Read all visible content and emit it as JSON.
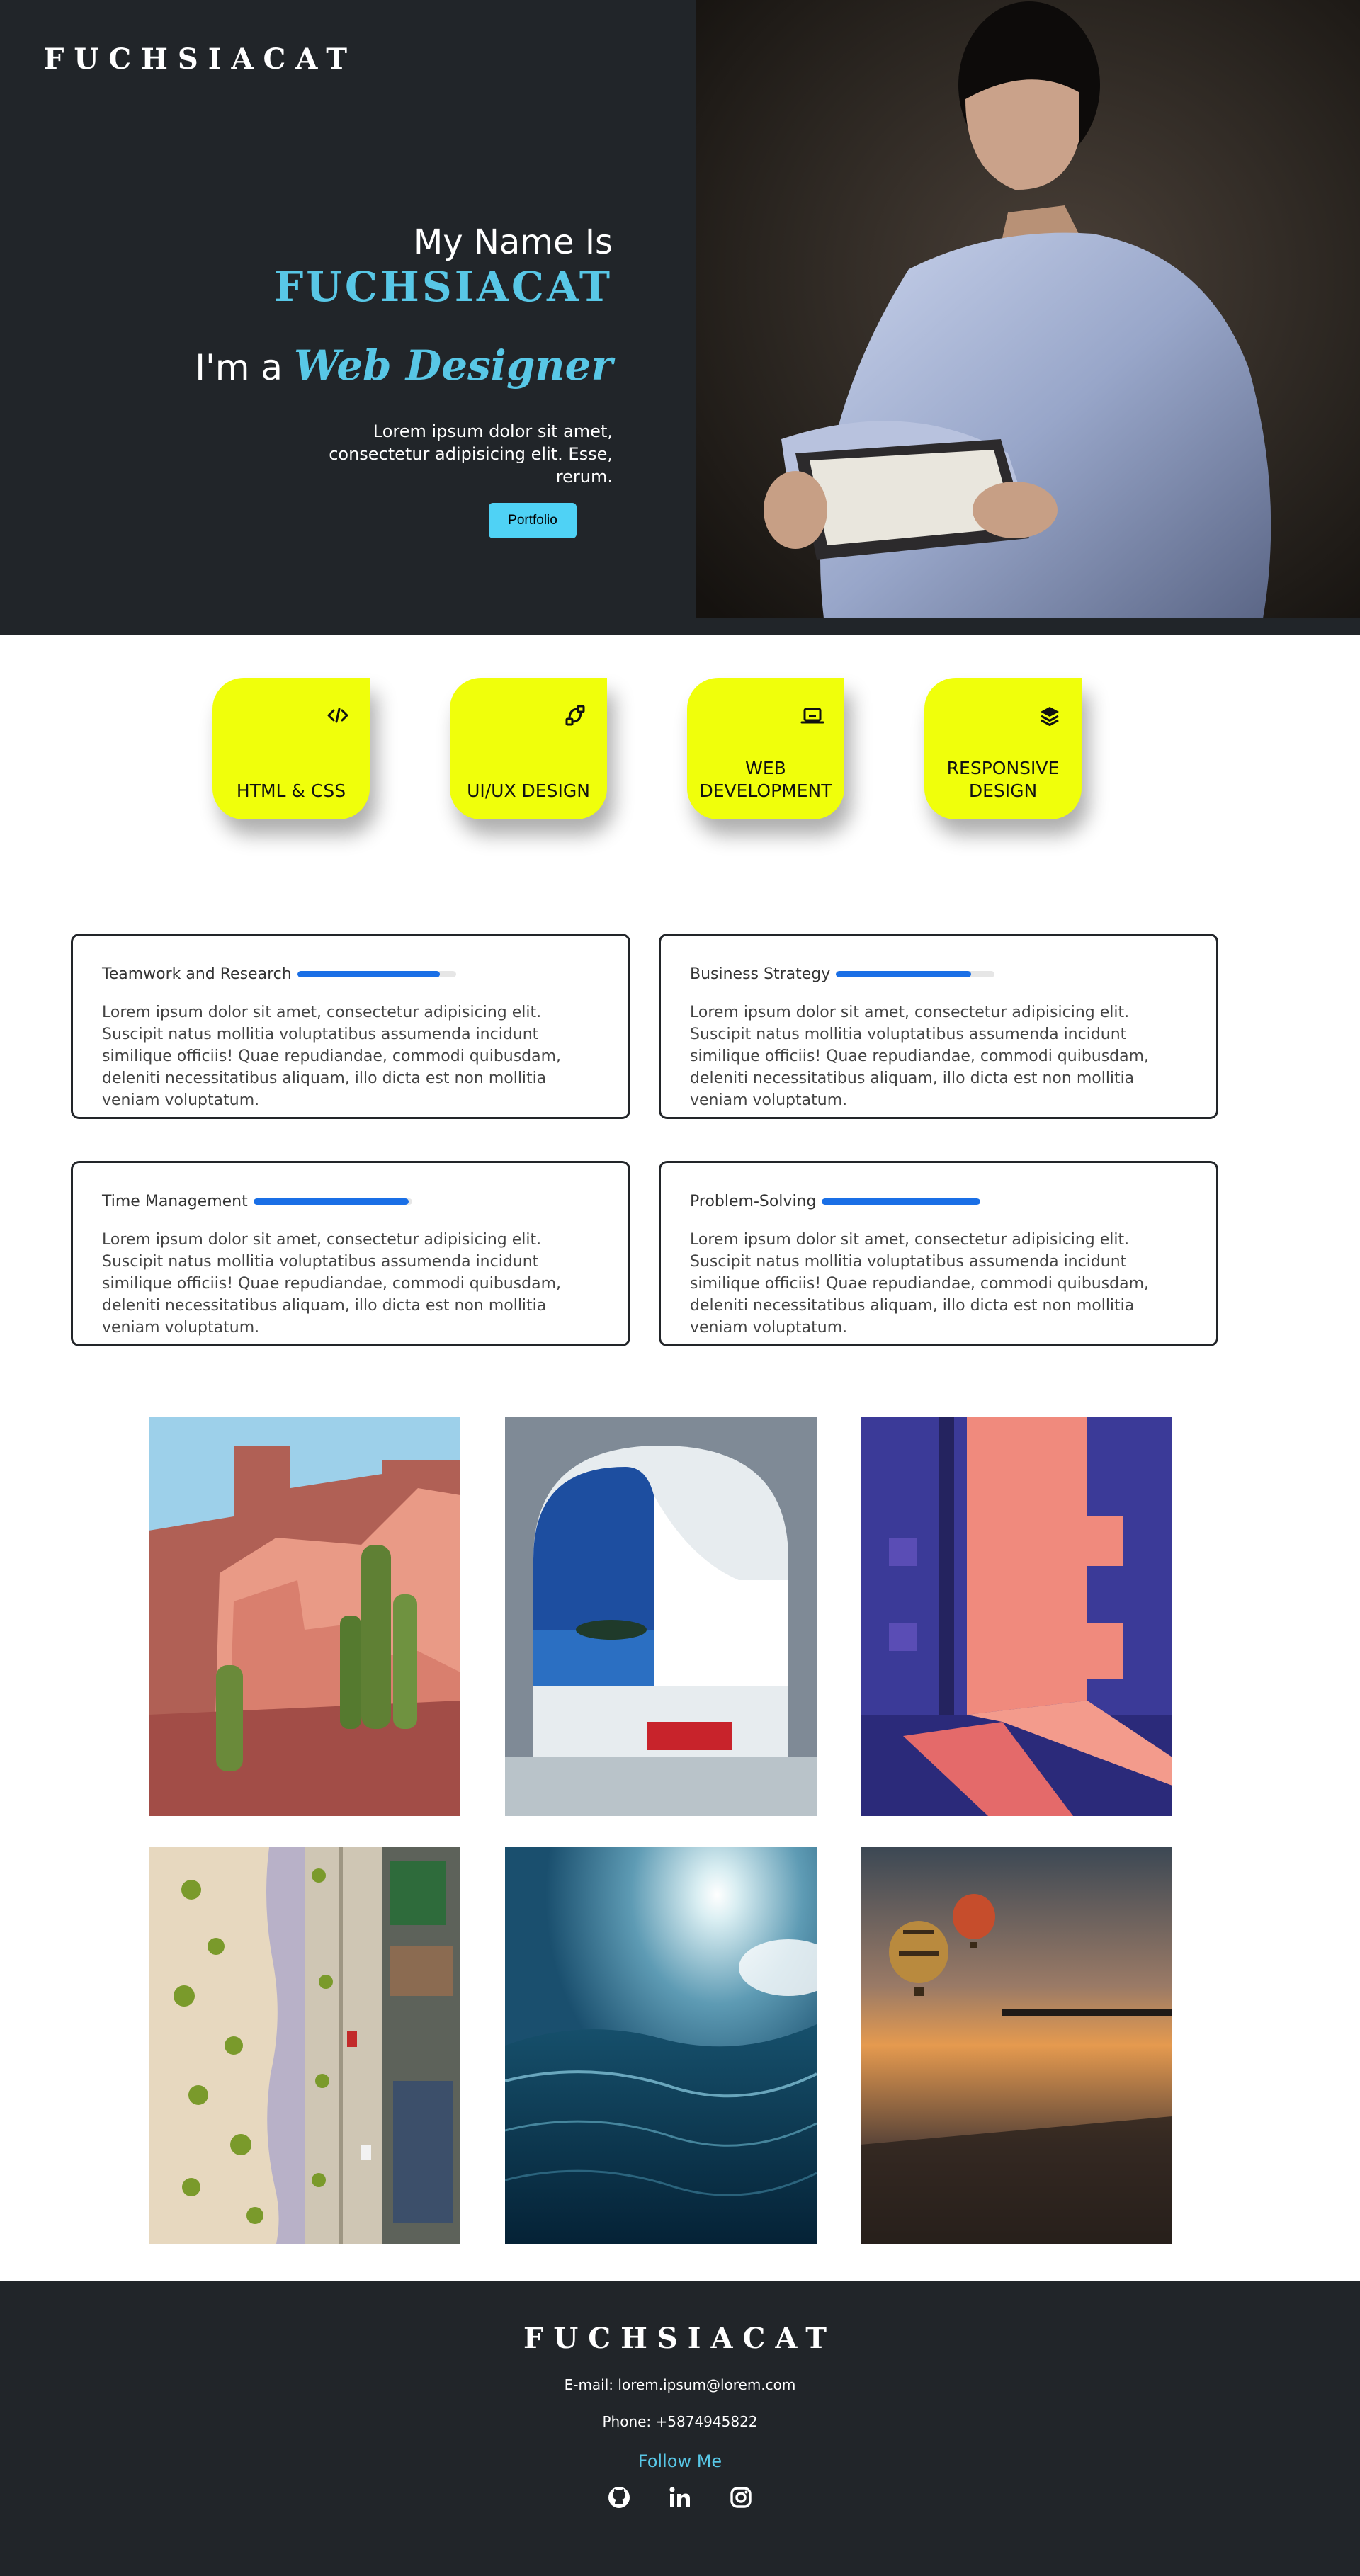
{
  "header": {
    "logo": "FUCHSIACAT",
    "menu_icon": "hamburger-menu-icon"
  },
  "hero": {
    "intro": "My Name Is",
    "name": "FUCHSIACAT",
    "role_prefix": "I'm a",
    "role": "Web Designer",
    "description": "Lorem ipsum dolor sit amet, consectetur adipisicing elit. Esse, rerum.",
    "button_label": "Portfolio",
    "photo": "woman-reading-book-photo"
  },
  "services": [
    {
      "label": "HTML & CSS",
      "icon": "code-icon"
    },
    {
      "label": "UI/UX DESIGN",
      "icon": "pen-tool-icon"
    },
    {
      "label": "WEB DEVELOPMENT",
      "icon": "laptop-icon"
    },
    {
      "label": "RESPONSIVE DESIGN",
      "icon": "layers-icon"
    }
  ],
  "skills": [
    {
      "name": "Teamwork and Research",
      "progress": 0.9,
      "text": "Lorem ipsum dolor sit amet, consectetur adipisicing elit. Suscipit natus mollitia voluptatibus assumenda incidunt similique officiis! Quae repudiandae, commodi quibusdam, deleniti necessitatibus aliquam, illo dicta est non mollitia veniam voluptatum."
    },
    {
      "name": "Business Strategy",
      "progress": 0.85,
      "text": "Lorem ipsum dolor sit amet, consectetur adipisicing elit. Suscipit natus mollitia voluptatibus assumenda incidunt similique officiis! Quae repudiandae, commodi quibusdam, deleniti necessitatibus aliquam, illo dicta est non mollitia veniam voluptatum."
    },
    {
      "name": "Time Management",
      "progress": 0.98,
      "text": "Lorem ipsum dolor sit amet, consectetur adipisicing elit. Suscipit natus mollitia voluptatibus assumenda incidunt similique officiis! Quae repudiandae, commodi quibusdam, deleniti necessitatibus aliquam, illo dicta est non mollitia veniam voluptatum."
    },
    {
      "name": "Problem-Solving",
      "progress": 1.0,
      "text": "Lorem ipsum dolor sit amet, consectetur adipisicing elit. Suscipit natus mollitia voluptatibus assumenda incidunt similique officiis! Quae repudiandae, commodi quibusdam, deleniti necessitatibus aliquam, illo dicta est non mollitia veniam voluptatum."
    }
  ],
  "gallery": [
    "desert-architecture-cactus-illustration",
    "white-arch-sea-view-illustration",
    "pink-blue-building-shadow-illustration",
    "aerial-beach-palm-road-photo",
    "ocean-wave-sun-photo",
    "hot-air-balloons-sunset-photo"
  ],
  "footer": {
    "logo": "FUCHSIACAT",
    "email": "E-mail: lorem.ipsum@lorem.com",
    "phone": "Phone: +5874945822",
    "follow": "Follow Me",
    "social": [
      "github-icon",
      "linkedin-icon",
      "instagram-icon"
    ]
  },
  "colors": {
    "dark": "#212529",
    "accent": "#58c7e6",
    "card_yellow": "#f0ff0b",
    "progress_blue": "#1a6fe6"
  }
}
